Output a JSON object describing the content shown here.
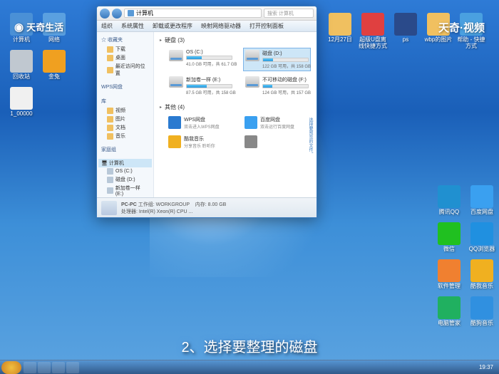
{
  "watermarks": {
    "left": "天奇生活",
    "right": "天奇·视频"
  },
  "caption": "2、选择要整理的磁盘",
  "desktop": {
    "left_icons": [
      {
        "label": "计算机",
        "color": "#4a90d6"
      },
      {
        "label": "网络",
        "color": "#5aa0e0"
      },
      {
        "label": "回收站",
        "color": "#c0c8d0"
      },
      {
        "label": "金兔",
        "color": "#f0a020"
      },
      {
        "label": "1_00000",
        "color": "#f0f0f0"
      }
    ],
    "top_icons": [
      {
        "label": "12月27日",
        "color": "#f0c060"
      },
      {
        "label": "超级U盘离线快捷方式",
        "color": "#e04040"
      },
      {
        "label": "ps",
        "color": "#2a4a8a"
      },
      {
        "label": "wbp的图片",
        "color": "#f0c060"
      },
      {
        "label": "帮助 - 快捷方式",
        "color": "#4aa0e0"
      }
    ],
    "right_icons": [
      {
        "label": "腾讯QQ",
        "color": "#2090d0"
      },
      {
        "label": "百度网盘",
        "color": "#3aa0f0"
      },
      {
        "label": "微信",
        "color": "#20c020"
      },
      {
        "label": "QQ浏览器",
        "color": "#2090e0"
      },
      {
        "label": "软件管理",
        "color": "#f08030"
      },
      {
        "label": "酷我音乐",
        "color": "#f0b020"
      },
      {
        "label": "电脑管家",
        "color": "#20b060"
      },
      {
        "label": "酷狗音乐",
        "color": "#3090e0"
      }
    ]
  },
  "explorer": {
    "title": "计算机",
    "search_placeholder": "搜索 计算机",
    "menu": [
      "组织",
      "系统属性",
      "卸载或更改程序",
      "映射网络驱动器",
      "打开控制面板"
    ],
    "sidebar": {
      "fav": {
        "hdr": "☆ 收藏夹",
        "items": [
          "下载",
          "桌面",
          "最近访问的位置"
        ]
      },
      "wps": {
        "hdr": "WPS网盘"
      },
      "lib": {
        "hdr": "库",
        "items": [
          "视频",
          "图片",
          "文档",
          "音乐"
        ]
      },
      "home": {
        "hdr": "家庭组"
      },
      "comp": {
        "hdr": "计算机",
        "items": [
          "OS (C:)",
          "磁盘 (D:)",
          "新加卷一样 (E:)"
        ]
      }
    },
    "groups": [
      {
        "hdr": "硬盘 (3)",
        "type": "drives",
        "items": [
          {
            "name": "OS (C:)",
            "info": "41.0 GB 可用，共 61.7 GB",
            "fill": 34
          },
          {
            "name": "磁盘 (D:)",
            "info": "122 GB 可用，共 158 GB",
            "fill": 23,
            "selected": true
          },
          {
            "name": "新加卷一样 (E:)",
            "info": "87.5 GB 可用，共 158 GB",
            "fill": 45
          },
          {
            "name": "不可移动的磁盘 (F:)",
            "info": "124 GB 可用，共 157 GB",
            "fill": 21
          }
        ]
      },
      {
        "hdr": "其他 (4)",
        "type": "other",
        "items": [
          {
            "name": "WPS网盘",
            "desc": "双击进入WPS网盘",
            "color": "#2a7ad0"
          },
          {
            "name": "百度网盘",
            "desc": "双击运行百度网盘",
            "color": "#3aa0f0"
          },
          {
            "name": "酷我音乐",
            "desc": "分享音乐 聆听你",
            "color": "#f0b020"
          },
          {
            "name": "",
            "desc": "",
            "color": "#888"
          }
        ]
      }
    ],
    "side_hint": "选择要预览的文件。",
    "status": {
      "name": "PC-PC",
      "wg_l": "工作组:",
      "wg_v": "WORKGROUP",
      "mem_l": "内存:",
      "mem_v": "8.00 GB",
      "cpu_l": "处理器:",
      "cpu_v": "Intel(R) Xeon(R) CPU ..."
    }
  },
  "taskbar": {
    "clock": "19:37"
  }
}
